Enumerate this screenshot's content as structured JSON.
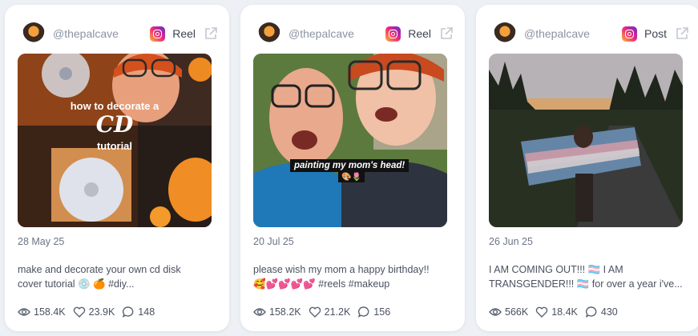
{
  "cards": [
    {
      "handle": "@thepalcave",
      "type": "Reel",
      "overlay": {
        "line1": "how to decorate a",
        "big": "CD",
        "line3": "tutorial"
      },
      "date": "28 May 25",
      "caption_line1": "make and decorate your own cd disk",
      "caption_line2": "cover tutorial 💿 🍊 #diy...",
      "stats": {
        "views": "158.4K",
        "likes": "23.9K",
        "comments": "148"
      }
    },
    {
      "handle": "@thepalcave",
      "type": "Reel",
      "overlay": {
        "line1": "painting my mom's head!",
        "line2": "🎨🌷"
      },
      "date": "20 Jul 25",
      "caption_line1": "please wish my mom a happy birthday!!",
      "caption_line2": "🥰💕💕💕💕 #reels #makeup",
      "stats": {
        "views": "158.2K",
        "likes": "21.2K",
        "comments": "156"
      }
    },
    {
      "handle": "@thepalcave",
      "type": "Post",
      "date": "26 Jun 25",
      "caption_line1": "I AM COMING OUT!!! 🏳️‍⚧️ I AM",
      "caption_line2": "TRANSGENDER!!! 🏳️‍⚧️ for over a year i've...",
      "stats": {
        "views": "566K",
        "likes": "18.4K",
        "comments": "430"
      }
    }
  ],
  "colors": {
    "background": "#edf0f4",
    "card": "#ffffff",
    "muted_text": "#8a93a3"
  },
  "icons": {
    "platform": "instagram-icon",
    "external": "external-link-icon",
    "views": "eye-icon",
    "likes": "heart-icon",
    "comments": "comment-icon"
  }
}
